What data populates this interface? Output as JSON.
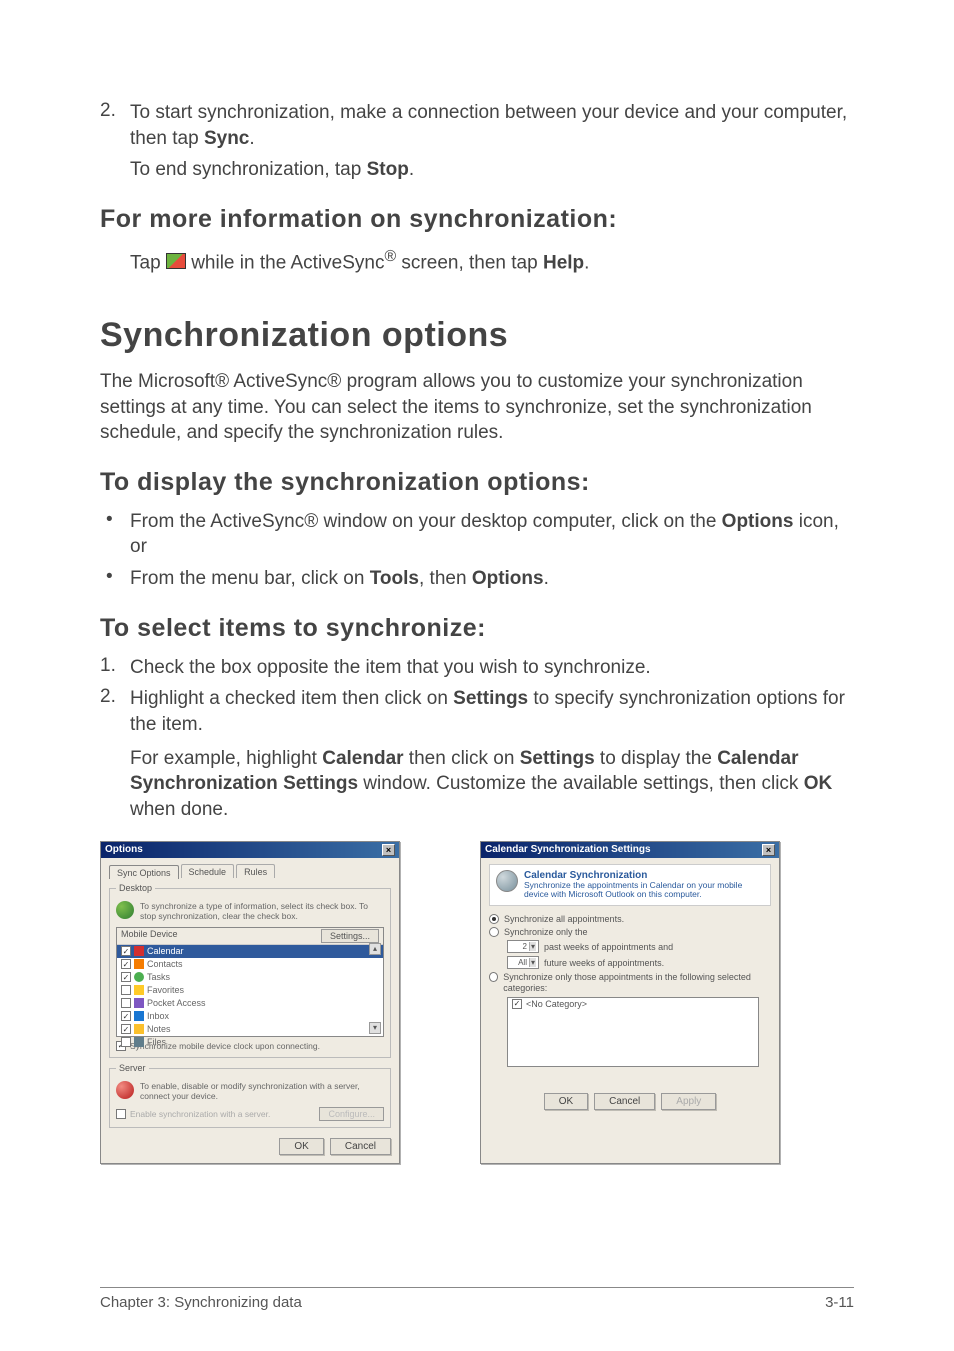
{
  "step2": {
    "num": "2.",
    "text_a": "To start synchronization, make a connection between your device and your computer, then tap ",
    "sync_bold": "Sync",
    "period": ".",
    "sub_a": "To end synchronization, tap ",
    "stop_bold": "Stop"
  },
  "h_moreinfo": "For more information on synchronization:",
  "moreinfo_line": {
    "a": "Tap ",
    "b": " while in the ActiveSync",
    "reg": "®",
    "c": " screen, then tap ",
    "help_bold": "Help",
    "d": "."
  },
  "h_main": "Synchronization options",
  "intro": "The Microsoft® ActiveSync® program allows you to customize your synchronization settings at any time. You can select the items to synchronize, set the synchronization schedule, and specify the synchronization rules.",
  "h_display": "To display the synchronization options:",
  "bul1": {
    "a": "From the ActiveSync® window on your desktop computer, click on the ",
    "b": "Options",
    "c": " icon, or"
  },
  "bul2": {
    "a": "From the menu bar, click on ",
    "b": "Tools",
    "c": ", then ",
    "d": "Options",
    "e": "."
  },
  "h_select": "To select items to synchronize:",
  "s1": {
    "num": "1.",
    "t": "Check the box opposite the item that you wish to synchronize."
  },
  "s2": {
    "num": "2.",
    "a": "Highlight a checked item then click on ",
    "b": "Settings",
    "c": " to specify synchronization options for the item."
  },
  "s2_sub": {
    "a": "For example, highlight ",
    "b": "Calendar",
    "c": " then click on ",
    "d": "Settings",
    "e": " to display the ",
    "f": "Calendar Synchronization Settings",
    "g": " window. Customize the available settings, then click ",
    "h": "OK",
    "i": " when done."
  },
  "dlg1": {
    "title": "Options",
    "close": "×",
    "tabs": [
      "Sync Options",
      "Schedule",
      "Rules"
    ],
    "frame_desktop": "Desktop",
    "info": "To synchronize a type of information, select its check box. To stop synchronization, clear the check box.",
    "hdr_left": "Mobile Device",
    "hdr_btn": "Settings...",
    "items": [
      {
        "chk": true,
        "ico": "ico-cal",
        "label": "Calendar",
        "sel": true
      },
      {
        "chk": true,
        "ico": "ico-con",
        "label": "Contacts",
        "sel": false
      },
      {
        "chk": true,
        "ico": "ico-task",
        "label": "Tasks",
        "sel": false
      },
      {
        "chk": false,
        "ico": "ico-fav",
        "label": "Favorites",
        "sel": false
      },
      {
        "chk": false,
        "ico": "ico-acc",
        "label": "Pocket Access",
        "sel": false
      },
      {
        "chk": true,
        "ico": "ico-inbox",
        "label": "Inbox",
        "sel": false
      },
      {
        "chk": true,
        "ico": "ico-notes",
        "label": "Notes",
        "sel": false
      },
      {
        "chk": false,
        "ico": "ico-files",
        "label": "Files",
        "sel": false
      }
    ],
    "chk_clock": "Synchronize mobile device clock upon connecting.",
    "frame_server": "Server",
    "server_info": "To enable, disable or modify synchronization with a server, connect your device.",
    "enable_srv": "Enable synchronization with a server.",
    "config_btn": "Configure...",
    "ok": "OK",
    "cancel": "Cancel"
  },
  "dlg2": {
    "title": "Calendar Synchronization Settings",
    "close": "×",
    "banner_title": "Calendar Synchronization",
    "banner_sub": "Synchronize the appointments in Calendar on your mobile device with Microsoft Outlook on this computer.",
    "r1": "Synchronize all appointments.",
    "r2": "Synchronize only the",
    "r2a_text": "past weeks of appointments and",
    "r2b_text": "future weeks of appointments.",
    "ddl1": "2",
    "ddl2": "All",
    "r3": "Synchronize only those appointments in the following selected categories:",
    "cat_item": "<No Category>",
    "ok": "OK",
    "cancel": "Cancel",
    "apply": "Apply"
  },
  "footer": {
    "left": "Chapter 3: Synchronizing data",
    "right": "3-11"
  }
}
